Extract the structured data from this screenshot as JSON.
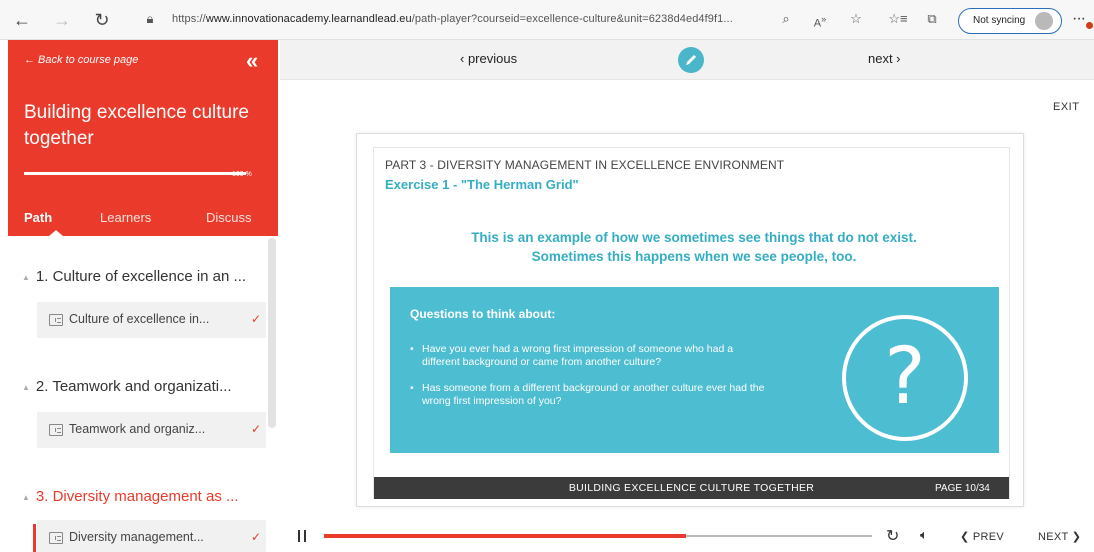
{
  "browser": {
    "url_prefix": "https://",
    "url_host": "www.innovationacademy.learnandlead.eu",
    "url_path": "/path-player?courseid=excellence-culture&unit=6238d4ed4f9f1...",
    "sync_label": "Not syncing",
    "icons": [
      "back-arrow-icon",
      "forward-arrow-icon",
      "reload-icon",
      "lock-icon",
      "read-aloud-icon",
      "favorite-add-icon",
      "favorites-icon",
      "collections-icon",
      "profile-avatar-icon",
      "more-menu-icon"
    ]
  },
  "sidebar": {
    "back_link": "← Back to course page",
    "collapse_label": "«",
    "course_title": "Building excellence culture together",
    "progress_percent": 100,
    "progress_label": "100 %",
    "tabs": [
      {
        "label": "Path",
        "active": true
      },
      {
        "label": "Learners",
        "active": false
      },
      {
        "label": "Discuss",
        "active": false
      }
    ],
    "sections": [
      {
        "label": "1. Culture of excellence in an ...",
        "lesson": "Culture of excellence in...",
        "check": "✓",
        "active": false
      },
      {
        "label": "2. Teamwork and organizati...",
        "lesson": "Teamwork and organiz...",
        "check": "✓",
        "active": false
      },
      {
        "label": "3. Diversity management as ...",
        "lesson": "Diversity management...",
        "check": "✓",
        "active": true
      }
    ]
  },
  "course_nav": {
    "previous": "‹ previous",
    "next": "next ›",
    "exit": "EXIT"
  },
  "slide": {
    "part_title": "PART 3 - DIVERSITY MANAGEMENT IN EXCELLENCE ENVIRONMENT",
    "exercise_title": "Exercise 1 - \"The Herman Grid\"",
    "message_line1": "This is an example of how we sometimes see things that do not exist.",
    "message_line2": "Sometimes this happens when we see people, too.",
    "questions_title": "Questions to think about:",
    "question1": "Have you ever had a wrong first impression of someone who had a different background or came from another culture?",
    "question2": "Has someone from a different background or another culture ever had the wrong first impression of you?",
    "question_mark": "?",
    "footer_title": "BUILDING EXCELLENCE CULTURE TOGETHER",
    "footer_page": "PAGE 10/34",
    "accent_color": "#35aec3",
    "box_color": "#4dbdd1"
  },
  "player": {
    "progress_fraction": 0.66,
    "prev_label": "❮ PREV",
    "next_label": "NEXT ❯"
  },
  "colors": {
    "brand_red": "#ea3a2b"
  }
}
